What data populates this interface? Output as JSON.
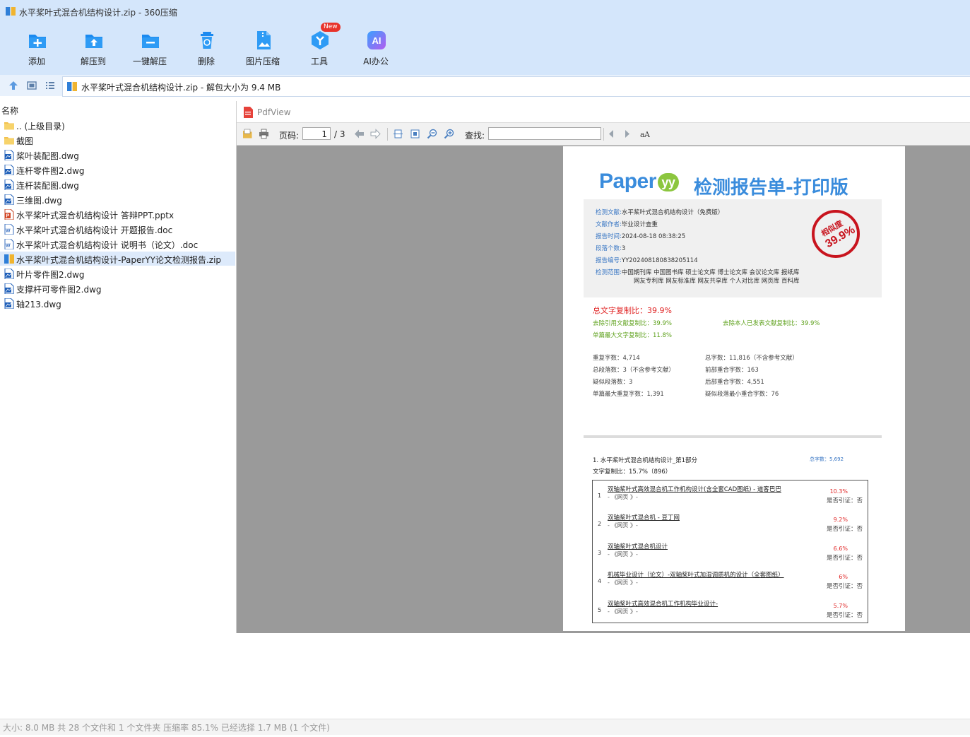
{
  "window": {
    "title": "水平桨叶式混合机结构设计.zip - 360压缩"
  },
  "toolbar": {
    "buttons": [
      {
        "label": "添加",
        "icon": "add-icon"
      },
      {
        "label": "解压到",
        "icon": "extract-to-icon"
      },
      {
        "label": "一键解压",
        "icon": "one-click-extract-icon"
      },
      {
        "label": "删除",
        "icon": "delete-icon"
      },
      {
        "label": "图片压缩",
        "icon": "image-compress-icon"
      },
      {
        "label": "工具",
        "icon": "tools-icon"
      },
      {
        "label": "AI办公",
        "icon": "ai-office-icon"
      }
    ],
    "new_badge": "New",
    "colors": {
      "bar_bg": "#d4e6fb",
      "icon_blue": "#1b8af0"
    }
  },
  "address": {
    "text": "水平桨叶式混合机结构设计.zip - 解包大小为 9.4 MB"
  },
  "filelist": {
    "header": "名称",
    "items": [
      {
        "name": ".. (上级目录)",
        "type": "folder"
      },
      {
        "name": "截图",
        "type": "folder"
      },
      {
        "name": "桨叶装配图.dwg",
        "type": "dwg"
      },
      {
        "name": "连杆零件图2.dwg",
        "type": "dwg"
      },
      {
        "name": "连杆装配图.dwg",
        "type": "dwg"
      },
      {
        "name": "三维图.dwg",
        "type": "dwg"
      },
      {
        "name": "水平桨叶式混合机结构设计 答辩PPT.pptx",
        "type": "pptx"
      },
      {
        "name": "水平桨叶式混合机结构设计 开题报告.doc",
        "type": "doc"
      },
      {
        "name": "水平桨叶式混合机结构设计 说明书（论文）.doc",
        "type": "doc"
      },
      {
        "name": "水平桨叶式混合机结构设计-PaperYY论文检测报告.zip",
        "type": "zip",
        "selected": true
      },
      {
        "name": "叶片零件图2.dwg",
        "type": "dwg"
      },
      {
        "name": "支撑杆可零件图2.dwg",
        "type": "dwg"
      },
      {
        "name": "轴213.dwg",
        "type": "dwg"
      }
    ]
  },
  "preview": {
    "title": "PdfView",
    "page_label": "页码:",
    "page_current": "1",
    "page_total": "/ 3",
    "find_label": "查找:",
    "find_value": ""
  },
  "report": {
    "logo_text": "Paper",
    "logo_yy": "yy",
    "heading": "检测报告单-打印版",
    "info": [
      {
        "k": "检测文献:",
        "v": "水平桨叶式混合机结构设计（免费版）"
      },
      {
        "k": "文献作者:",
        "v": "毕业设计查重"
      },
      {
        "k": "报告时间:",
        "v": "2024-08-18 08:38:25"
      },
      {
        "k": "段落个数:",
        "v": "3"
      },
      {
        "k": "报告编号:",
        "v": "YY202408180838205114"
      },
      {
        "k": "检测范围:",
        "v": "中国期刊库 中国图书库 硕士论文库 博士论文库 会议论文库 报纸库"
      }
    ],
    "scope_line2": "网友专利库 网友标准库 网友共享库 个人对比库 网页库 百科库",
    "stamp_label": "相似度",
    "stamp_value": "39.9%",
    "total_ratio": "总文字复制比：39.9%",
    "ratio_excl_ref": "去除引用文献复制比：39.9%",
    "ratio_excl_self": "去除本人已发表文献复制比：39.9%",
    "ratio_single_max": "单篇最大文字复制比：11.8%",
    "stats_left": [
      "重复字数：4,714",
      "总段落数：3（不含参考文献）",
      "疑似段落数：3",
      "单篇最大重复字数：1,391"
    ],
    "stats_right": [
      "总字数：11,816（不含参考文献）",
      "前部重合字数：163",
      "后部重合字数：4,551",
      "疑似段落最小重合字数：76"
    ],
    "section_title": "1. 水平桨叶式混合机结构设计_第1部分",
    "section_total": "总字数：5,692",
    "section_ratio": "文字复制比：15.7%（896）",
    "sources": [
      {
        "num": "1",
        "title": "双轴桨叶式高效混合机工作机构设计(含全套CAD图纸) - 道客巴巴",
        "src": "- 《网页 》-",
        "pct": "10.3%",
        "cite": "是否引证：否"
      },
      {
        "num": "2",
        "title": "双轴桨叶式混合机 - 豆丁网",
        "src": "- 《网页 》-",
        "pct": "9.2%",
        "cite": "是否引证：否"
      },
      {
        "num": "3",
        "title": "双轴桨叶式混合机设计",
        "src": "- 《网页 》-",
        "pct": "6.6%",
        "cite": "是否引证：否"
      },
      {
        "num": "4",
        "title": "机械毕业设计（论文）-双轴桨叶式加湿调质机的设计（全套图纸）",
        "src": "- 《网页 》-",
        "pct": "6%",
        "cite": "是否引证：否"
      },
      {
        "num": "5",
        "title": "双轴桨叶式高效混合机工作机构毕业设计-",
        "src": "- 《网页 》-",
        "pct": "5.7%",
        "cite": "是否引证：否"
      }
    ]
  },
  "status": {
    "text": "大小: 8.0 MB 共 28 个文件和 1 个文件夹 压缩率 85.1% 已经选择 1.7 MB (1 个文件)"
  }
}
